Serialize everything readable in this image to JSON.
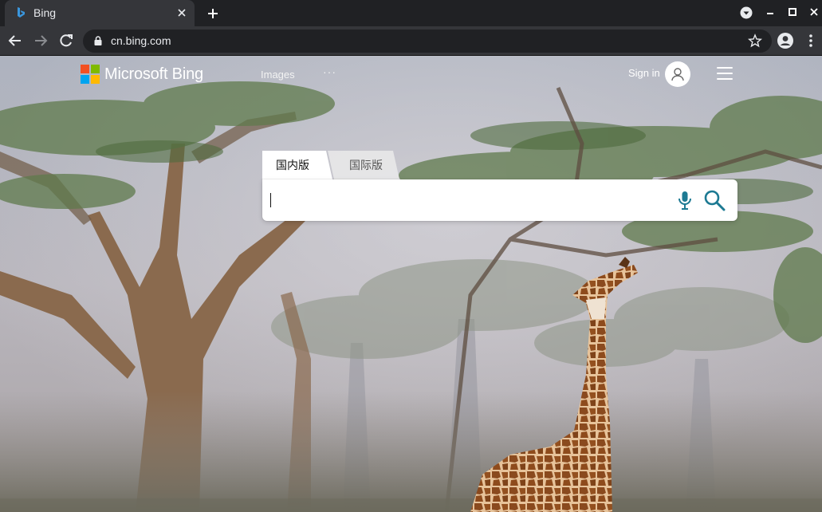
{
  "browser": {
    "tab_title": "Bing",
    "url": "cn.bing.com"
  },
  "page": {
    "brand": "Microsoft Bing",
    "nav": {
      "images": "Images",
      "more": "···"
    },
    "signin": "Sign in",
    "search_tabs": [
      "国内版",
      "国际版"
    ],
    "search": {
      "value": "",
      "placeholder": ""
    }
  },
  "colors": {
    "accent": "#1d7a93",
    "ms_red": "#f25022",
    "ms_green": "#7fba00",
    "ms_blue": "#00a4ef",
    "ms_yellow": "#ffb900"
  },
  "icons": [
    "bing-favicon-icon",
    "close-icon",
    "plus-icon",
    "media-control-icon",
    "minimize-icon",
    "maximize-icon",
    "close-window-icon",
    "back-arrow-icon",
    "forward-arrow-icon",
    "reload-icon",
    "lock-icon",
    "star-icon",
    "profile-icon",
    "kebab-menu-icon",
    "user-icon",
    "hamburger-icon",
    "microphone-icon",
    "search-icon"
  ]
}
